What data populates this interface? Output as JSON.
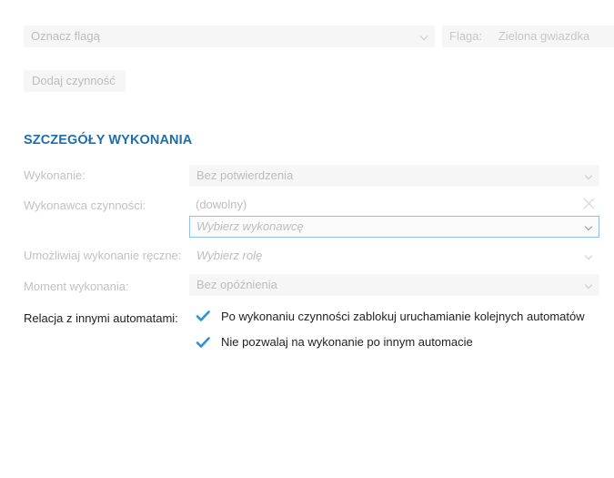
{
  "top": {
    "flag_select": {
      "value": "Oznacz flagą"
    },
    "flag_label": "Flaga:",
    "flag_value": "Zielona gwiazdka",
    "add_action": "Dodaj czynność"
  },
  "section": {
    "title": "SZCZEGÓŁY WYKONANIA",
    "rows": {
      "execution": {
        "label": "Wykonanie:",
        "value": "Bez potwierdzenia"
      },
      "executor": {
        "label": "Wykonawca czynności:",
        "value": "(dowolny)",
        "picker_placeholder": "Wybierz wykonawcę"
      },
      "manual": {
        "label": "Umożliwiaj wykonanie ręczne:",
        "placeholder": "Wybierz rolę"
      },
      "moment": {
        "label": "Moment wykonania:",
        "value": "Bez opóźnienia"
      },
      "relation": {
        "label": "Relacja z innymi automatami:",
        "options": [
          {
            "text": "Po wykonaniu czynności zablokuj uruchamianie kolejnych automatów",
            "checked": true
          },
          {
            "text": "Nie pozwalaj na wykonanie po innym automacie",
            "checked": true
          }
        ]
      }
    }
  },
  "colors": {
    "accent": "#1e6fa8",
    "check": "#2e8fd1",
    "focus_border": "#8cc4ea"
  },
  "icons": {
    "check": "checkmark-icon",
    "chevron": "chevron-down-icon",
    "clear": "close-icon"
  }
}
